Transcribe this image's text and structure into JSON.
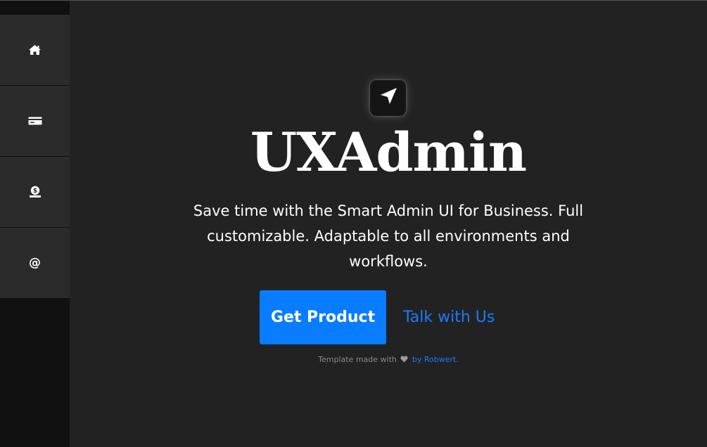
{
  "sidebar": {
    "items": [
      {
        "name": "home",
        "icon": "home-icon"
      },
      {
        "name": "card",
        "icon": "credit-card-icon"
      },
      {
        "name": "money",
        "icon": "money-bag-icon"
      },
      {
        "name": "contact",
        "icon": "at-icon",
        "glyph": "@"
      }
    ]
  },
  "hero": {
    "logo_icon": "location-arrow-icon",
    "title": "UXAdmin",
    "tagline": "Save time with the Smart Admin UI for Business. Full customizable. Adaptable to all environments and workflows.",
    "primary_cta": "Get Product",
    "secondary_cta": "Talk with Us"
  },
  "footer": {
    "prefix": "Template made with",
    "heart_icon": "heart-icon",
    "author_link": "by Robwert."
  },
  "colors": {
    "background": "#222222",
    "sidebar": "#111111",
    "sidebar_item": "#2b2b2b",
    "accent": "#0a7cff"
  }
}
